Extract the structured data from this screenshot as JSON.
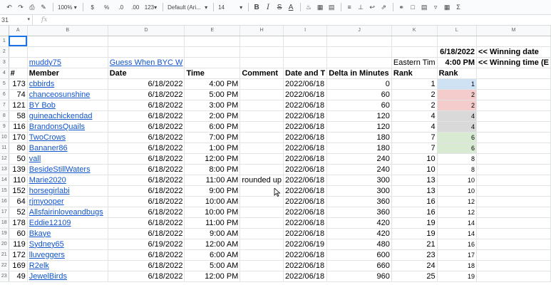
{
  "toolbar": {
    "zoom": "100%",
    "currency": "$",
    "percent": "%",
    "decimal_decrease": ".0",
    "decimal_increase": ".00",
    "number_format": "123",
    "font": "Default (Ari...",
    "font_size": "14",
    "bold": "B",
    "italic": "I",
    "strike": "S",
    "text_color": "A"
  },
  "formula_bar": {
    "cell_ref": "31",
    "fx": "fx"
  },
  "columns": [
    "A",
    "B",
    "D",
    "E",
    "H",
    "I",
    "J",
    "K",
    "L",
    "M"
  ],
  "row2": {
    "winning_date_value": "6/18/2022",
    "winning_date_label": "<< Winning date"
  },
  "row3": {
    "muddy": "muddy75",
    "guess": "Guess When BYC W",
    "eastern": "Eastern Tim",
    "winning_time_value": "4:00 PM",
    "winning_time_label": "<< Winning time (E"
  },
  "headers": {
    "num": "#",
    "member": "Member",
    "date": "Date",
    "time": "Time",
    "comment": "Comment",
    "date_t": "Date and T",
    "delta": "Delta in Minutes",
    "rank": "Rank",
    "rank2": "Rank"
  },
  "rows": [
    {
      "row": "5",
      "num": "173",
      "member": "cbbirds",
      "date": "6/18/2022",
      "time": "4:00 PM",
      "comment": "",
      "dt": "2022/06/18",
      "delta": "0",
      "rank": "1",
      "rank2": "1",
      "color": "blue"
    },
    {
      "row": "6",
      "num": "74",
      "member": "chanceosunshine",
      "date": "6/18/2022",
      "time": "5:00 PM",
      "comment": "",
      "dt": "2022/06/18",
      "delta": "60",
      "rank": "2",
      "rank2": "2",
      "color": "red"
    },
    {
      "row": "7",
      "num": "121",
      "member": "BY Bob",
      "date": "6/18/2022",
      "time": "3:00 PM",
      "comment": "",
      "dt": "2022/06/18",
      "delta": "60",
      "rank": "2",
      "rank2": "2",
      "color": "red"
    },
    {
      "row": "8",
      "num": "58",
      "member": "guineachickendad",
      "date": "6/18/2022",
      "time": "2:00 PM",
      "comment": "",
      "dt": "2022/06/18",
      "delta": "120",
      "rank": "4",
      "rank2": "4",
      "color": "gray"
    },
    {
      "row": "9",
      "num": "116",
      "member": "BrandonsQuails",
      "date": "6/18/2022",
      "time": "6:00 PM",
      "comment": "",
      "dt": "2022/06/18",
      "delta": "120",
      "rank": "4",
      "rank2": "4",
      "color": "gray"
    },
    {
      "row": "10",
      "num": "170",
      "member": "TwoCrows",
      "date": "6/18/2022",
      "time": "7:00 PM",
      "comment": "",
      "dt": "2022/06/18",
      "delta": "180",
      "rank": "7",
      "rank2": "6",
      "color": "green"
    },
    {
      "row": "11",
      "num": "80",
      "member": "Bananer86",
      "date": "6/18/2022",
      "time": "1:00 PM",
      "comment": "",
      "dt": "2022/06/18",
      "delta": "180",
      "rank": "7",
      "rank2": "6",
      "color": "green"
    },
    {
      "row": "12",
      "num": "50",
      "member": "vall",
      "date": "6/18/2022",
      "time": "12:00 PM",
      "comment": "",
      "dt": "2022/06/18",
      "delta": "240",
      "rank": "10",
      "rank2": "8",
      "color": ""
    },
    {
      "row": "13",
      "num": "139",
      "member": "BesideStillWaters",
      "date": "6/18/2022",
      "time": "8:00 PM",
      "comment": "",
      "dt": "2022/06/18",
      "delta": "240",
      "rank": "10",
      "rank2": "8",
      "color": ""
    },
    {
      "row": "14",
      "num": "110",
      "member": "Marie2020",
      "date": "6/18/2022",
      "time": "11:00 AM",
      "comment": "rounded up",
      "dt": "2022/06/18",
      "delta": "300",
      "rank": "13",
      "rank2": "10",
      "color": ""
    },
    {
      "row": "15",
      "num": "152",
      "member": "horsegirlabi",
      "date": "6/18/2022",
      "time": "9:00 PM",
      "comment": "",
      "dt": "2022/06/18",
      "delta": "300",
      "rank": "13",
      "rank2": "10",
      "color": ""
    },
    {
      "row": "16",
      "num": "64",
      "member": "rjmyooper",
      "date": "6/18/2022",
      "time": "10:00 AM",
      "comment": "",
      "dt": "2022/06/18",
      "delta": "360",
      "rank": "16",
      "rank2": "12",
      "color": ""
    },
    {
      "row": "17",
      "num": "52",
      "member": "Allsfairinloveandbugs",
      "date": "6/18/2022",
      "time": "10:00 PM",
      "comment": "",
      "dt": "2022/06/18",
      "delta": "360",
      "rank": "16",
      "rank2": "12",
      "color": ""
    },
    {
      "row": "18",
      "num": "178",
      "member": "Eddie12109",
      "date": "6/18/2022",
      "time": "11:00 PM",
      "comment": "",
      "dt": "2022/06/18",
      "delta": "420",
      "rank": "19",
      "rank2": "14",
      "color": ""
    },
    {
      "row": "19",
      "num": "60",
      "member": "Bkaye",
      "date": "6/18/2022",
      "time": "9:00 AM",
      "comment": "",
      "dt": "2022/06/18",
      "delta": "420",
      "rank": "19",
      "rank2": "14",
      "color": ""
    },
    {
      "row": "20",
      "num": "119",
      "member": "Sydney65",
      "date": "6/19/2022",
      "time": "12:00 AM",
      "comment": "",
      "dt": "2022/06/19",
      "delta": "480",
      "rank": "21",
      "rank2": "16",
      "color": ""
    },
    {
      "row": "21",
      "num": "172",
      "member": "lluveggers",
      "date": "6/18/2022",
      "time": "6:00 AM",
      "comment": "",
      "dt": "2022/06/18",
      "delta": "600",
      "rank": "23",
      "rank2": "17",
      "color": ""
    },
    {
      "row": "22",
      "num": "169",
      "member": "R2elk",
      "date": "6/18/2022",
      "time": "5:00 AM",
      "comment": "",
      "dt": "2022/06/18",
      "delta": "660",
      "rank": "24",
      "rank2": "18",
      "color": ""
    },
    {
      "row": "23",
      "num": "49",
      "member": "JewelBirds",
      "date": "6/18/2022",
      "time": "12:00 PM",
      "comment": "",
      "dt": "2022/06/18",
      "delta": "960",
      "rank": "25",
      "rank2": "19",
      "color": ""
    }
  ]
}
